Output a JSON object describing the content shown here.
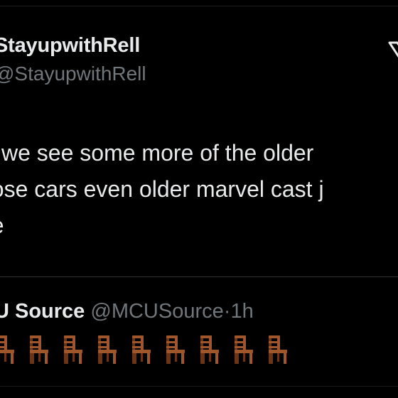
{
  "tweet": {
    "display_name": "StayupwithRell",
    "handle": "@StayupwithRell",
    "lines": [
      "ly we see some more of the older ",
      "hose cars even older marvel cast j",
      "ne"
    ]
  },
  "quote": {
    "name": "U Source",
    "handle": "@MCUSource",
    "separator": "·",
    "time": "1h",
    "emoji": [
      "chair-icon",
      "chair-icon",
      "chair-icon",
      "chair-icon",
      "chair-icon",
      "chair-icon",
      "chair-icon",
      "chair-icon",
      "chair-icon"
    ]
  },
  "colors": {
    "background": "#000000",
    "primary_text": "#e7e9ea",
    "secondary_text": "#71767b",
    "divider": "#2f3336",
    "chair_wood": "#a0562b"
  },
  "icons": {
    "logo": "x-logo-icon"
  }
}
